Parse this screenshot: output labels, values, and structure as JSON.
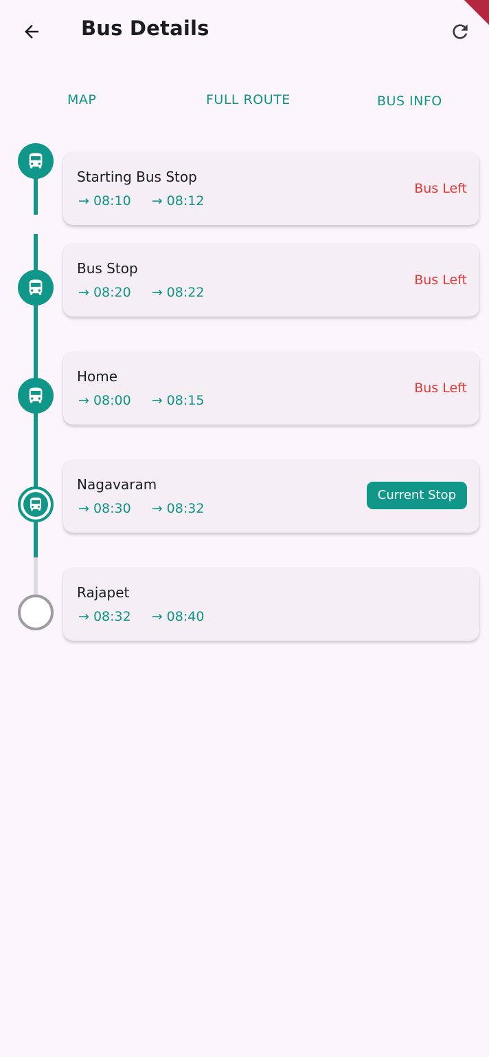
{
  "app_bar": {
    "title": "Bus Details",
    "back_icon": "arrow-left-icon",
    "refresh_icon": "refresh-icon"
  },
  "tabs": [
    {
      "label": "MAP"
    },
    {
      "label": "FULL ROUTE"
    },
    {
      "label": "BUS INFO"
    }
  ],
  "stops": [
    {
      "name": "Starting Bus Stop",
      "arrival": "→ 08:10",
      "departure": "→ 08:12",
      "status": "Bus Left",
      "state": "passed"
    },
    {
      "name": "Bus Stop",
      "arrival": "→ 08:20",
      "departure": "→ 08:22",
      "status": "Bus Left",
      "state": "passed"
    },
    {
      "name": "Home",
      "arrival": "→ 08:00",
      "departure": "→ 08:15",
      "status": "Bus Left",
      "state": "passed"
    },
    {
      "name": "Nagavaram",
      "arrival": "→ 08:30",
      "departure": "→ 08:32",
      "status": "Current Stop",
      "state": "current"
    },
    {
      "name": "Rajapet",
      "arrival": "→ 08:32",
      "departure": "→ 08:40",
      "status": "",
      "state": "upcoming"
    }
  ],
  "colors": {
    "accent": "#11978a",
    "status_left": "#e53935",
    "background": "#fcf5fc",
    "card": "#f5eff5",
    "upcoming": "#9e9ea2"
  }
}
